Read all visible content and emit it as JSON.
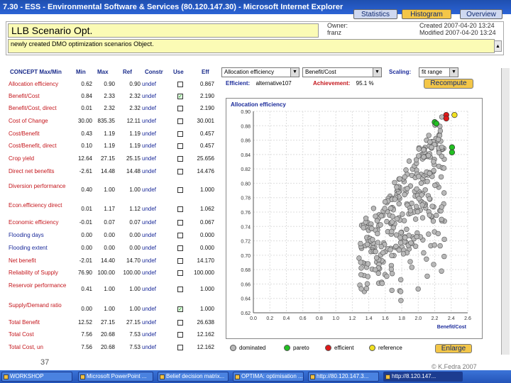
{
  "window": {
    "title": "7.30 - ESS - Environmental Software & Services (80.120.147.30) - Microsoft Internet Explorer"
  },
  "top_buttons": {
    "statistics": "Statistics",
    "histogram": "Histogram",
    "overview": "Overview"
  },
  "header": {
    "title": "LLB Scenario Opt.",
    "owner_label": "Owner:",
    "owner_value": "franz",
    "created_label": "Created",
    "created_value": "2007-04-20 13:24",
    "modified_label": "Modified",
    "modified_value": "2007-04-20 13:24",
    "description": "newly created DMO optimization scenarios Object."
  },
  "table": {
    "headers": [
      "CONCEPT Max/Min",
      "Min",
      "Max",
      "Ref",
      "Constr",
      "Use",
      "Eff"
    ],
    "rows": [
      {
        "name": "Allocation efficiency",
        "min": "0.62",
        "max": "0.90",
        "ref": "0.90",
        "constr": "undef",
        "use": false,
        "eff": "0.867",
        "color": "red"
      },
      {
        "name": "Benefit/Cost",
        "min": "0.84",
        "max": "2.33",
        "ref": "2.32",
        "constr": "undef",
        "use": true,
        "eff": "2.190",
        "color": "red"
      },
      {
        "name": "Benefit/Cost, direct",
        "min": "0.01",
        "max": "2.32",
        "ref": "2.32",
        "constr": "undef",
        "use": false,
        "eff": "2.190",
        "color": "red"
      },
      {
        "name": "Cost of Change",
        "min": "30.00",
        "max": "835.35",
        "ref": "12.11",
        "constr": "undef",
        "use": false,
        "eff": "30.001",
        "color": "red"
      },
      {
        "name": "Cost/Benefit",
        "min": "0.43",
        "max": "1.19",
        "ref": "1.19",
        "constr": "undef",
        "use": false,
        "eff": "0.457",
        "color": "red"
      },
      {
        "name": "Cost/Benefit, direct",
        "min": "0.10",
        "max": "1.19",
        "ref": "1.19",
        "constr": "undef",
        "use": false,
        "eff": "0.457",
        "color": "red"
      },
      {
        "name": "Crop yield",
        "min": "12.64",
        "max": "27.15",
        "ref": "25.15",
        "constr": "undef",
        "use": false,
        "eff": "25.656",
        "color": "red"
      },
      {
        "name": "Direct net benefits",
        "min": "-2.61",
        "max": "14.48",
        "ref": "14.48",
        "constr": "undef",
        "use": false,
        "eff": "14.476",
        "color": "red"
      },
      {
        "name": "Diversion performance",
        "min": "0.40",
        "max": "1.00",
        "ref": "1.00",
        "constr": "undef",
        "use": false,
        "eff": "1.000",
        "color": "red",
        "two": true
      },
      {
        "name": "Econ.efficiency direct",
        "min": "0.01",
        "max": "1.17",
        "ref": "1.12",
        "constr": "undef",
        "use": false,
        "eff": "1.062",
        "color": "red",
        "two": true
      },
      {
        "name": "Economic efficiency",
        "min": "-0.01",
        "max": "0.07",
        "ref": "0.07",
        "constr": "undef",
        "use": false,
        "eff": "0.067",
        "color": "red"
      },
      {
        "name": "Flooding days",
        "min": "0.00",
        "max": "0.00",
        "ref": "0.00",
        "constr": "undef",
        "use": false,
        "eff": "0.000",
        "color": "blue"
      },
      {
        "name": "Flooding extent",
        "min": "0.00",
        "max": "0.00",
        "ref": "0.00",
        "constr": "undef",
        "use": false,
        "eff": "0.000",
        "color": "blue"
      },
      {
        "name": "Net benefit",
        "min": "-2.01",
        "max": "14.40",
        "ref": "14.70",
        "constr": "undef",
        "use": false,
        "eff": "14.170",
        "color": "red"
      },
      {
        "name": "Reliability of Supply",
        "min": "76.90",
        "max": "100.00",
        "ref": "100.00",
        "constr": "undef",
        "use": false,
        "eff": "100.000",
        "color": "red"
      },
      {
        "name": "Reservoir performance",
        "min": "0.41",
        "max": "1.00",
        "ref": "1.00",
        "constr": "undef",
        "use": false,
        "eff": "1.000",
        "color": "red",
        "two": true
      },
      {
        "name": "Supply/Demand ratio",
        "min": "0.00",
        "max": "1.00",
        "ref": "1.00",
        "constr": "undef",
        "use": true,
        "eff": "1.000",
        "color": "red",
        "two": true
      },
      {
        "name": "Total Benefit",
        "min": "12.52",
        "max": "27.15",
        "ref": "27.15",
        "constr": "undef",
        "use": false,
        "eff": "26.638",
        "color": "red"
      },
      {
        "name": "Total Cost",
        "min": "7.56",
        "max": "20.68",
        "ref": "7.53",
        "constr": "undef",
        "use": false,
        "eff": "12.162",
        "color": "red"
      },
      {
        "name": "Total Cost, un",
        "min": "7.56",
        "max": "20.68",
        "ref": "7.53",
        "constr": "undef",
        "use": false,
        "eff": "12.162",
        "color": "red"
      }
    ]
  },
  "controls": {
    "y_select": "Allocation efficiency",
    "x_select": "Benefit/Cost",
    "scaling_label": "Scaling:",
    "scaling_select": "fit range",
    "efficient_label": "Efficient:",
    "efficient_value": "alternative107",
    "achievement_label": "Achievement:",
    "achievement_value": "95.1 %",
    "recompute": "Recompute"
  },
  "chart_data": {
    "type": "scatter",
    "title": "Allocation efficiency",
    "xlabel": "Benefit/Cost",
    "ylabel": "",
    "xlim": [
      0.0,
      2.6
    ],
    "ylim": [
      0.62,
      0.9
    ],
    "xticks": [
      "0.0",
      "0.2",
      "0.4",
      "0.6",
      "0.8",
      "1.0",
      "1.2",
      "1.4",
      "1.6",
      "1.8",
      "2.0",
      "2.2",
      "2.4",
      "2.6"
    ],
    "yticks": [
      "0.62",
      "0.64",
      "0.66",
      "0.68",
      "0.70",
      "0.72",
      "0.74",
      "0.76",
      "0.78",
      "0.80",
      "0.82",
      "0.84",
      "0.86",
      "0.88",
      "0.90"
    ],
    "cloud": {
      "seed": 7,
      "count": 330,
      "x_range": [
        1.28,
        2.32
      ],
      "y_range": [
        0.64,
        0.895
      ]
    },
    "series": [
      {
        "name": "dominated",
        "color": "#b8b8b8"
      },
      {
        "name": "pareto",
        "color": "#22c022",
        "points": [
          [
            2.41,
            0.85
          ],
          [
            2.41,
            0.843
          ],
          [
            2.2,
            0.885
          ],
          [
            2.22,
            0.883
          ]
        ]
      },
      {
        "name": "efficient",
        "color": "#e01818",
        "points": [
          [
            2.34,
            0.895
          ],
          [
            2.34,
            0.89
          ]
        ]
      },
      {
        "name": "reference",
        "color": "#f0e020",
        "points": [
          [
            2.44,
            0.895
          ]
        ]
      }
    ]
  },
  "legend": {
    "dominated": "dominated",
    "pareto": "pareto",
    "efficient": "efficient",
    "reference": "reference",
    "enlarge": "Enlarge"
  },
  "footer": {
    "slide_number": "37",
    "copyright": "© K.Fedra 2007"
  },
  "taskbar": {
    "items": [
      "WORKSHOP",
      "Microsoft PowerPoint ...",
      "Belief decision matrix...",
      "OPTIMA: optimisation ...",
      "http://80.120.147.3...",
      "http://8.120.147..."
    ]
  }
}
